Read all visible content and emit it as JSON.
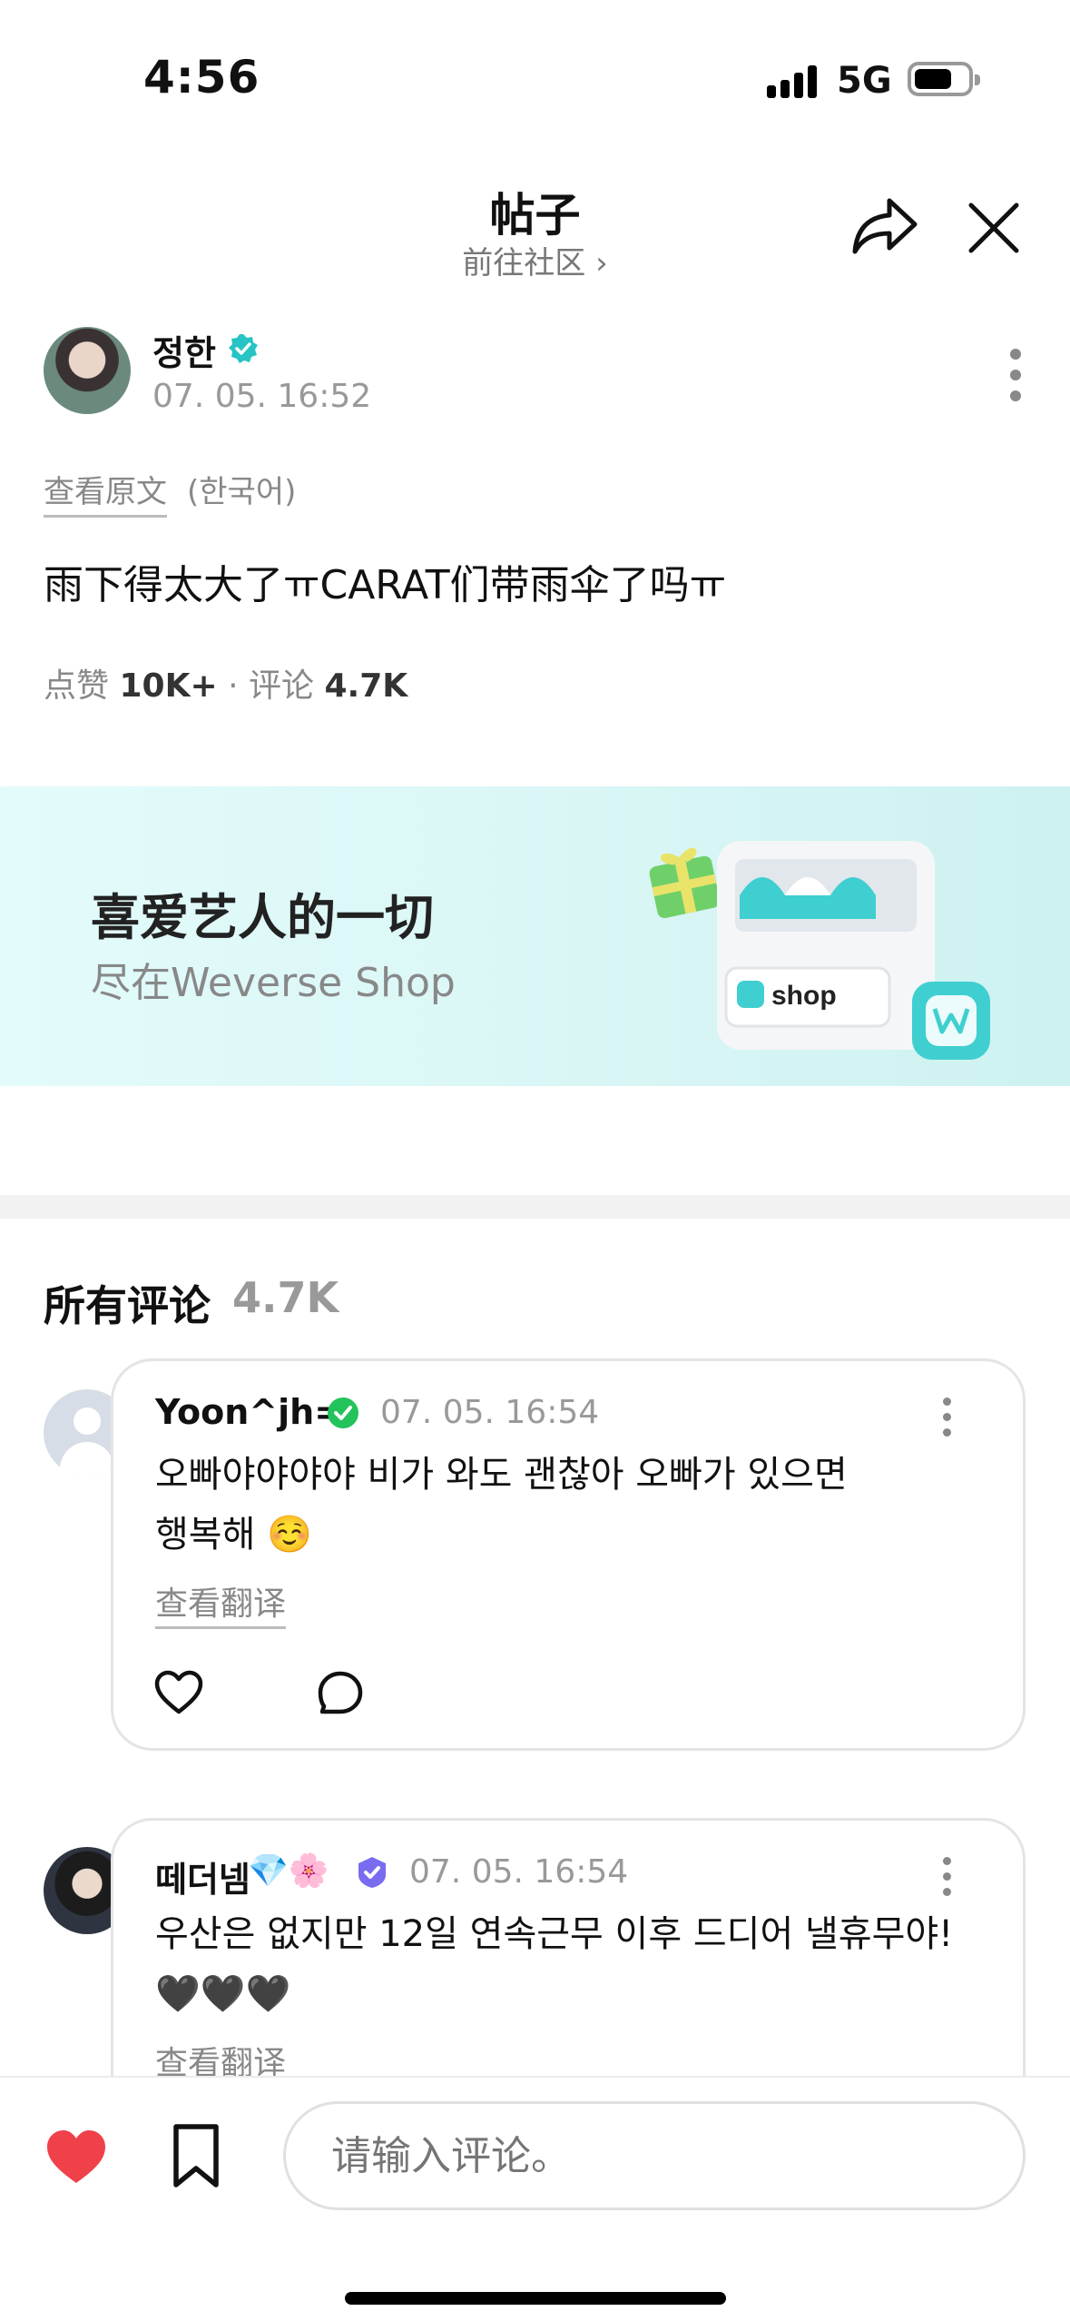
{
  "status_bar": {
    "time": "4:56",
    "network": "5G",
    "battery_level": 0.72
  },
  "header": {
    "title": "帖子",
    "subtitle": "前往社区 ›",
    "share_icon": "share-icon",
    "close_icon": "close-icon"
  },
  "post": {
    "author": "정한",
    "time": "07. 05. 16:52",
    "view_original": "查看原文",
    "original_language": "(한국어)",
    "body": "雨下得太大了ㅠCARAT们带雨伞了吗ㅠ",
    "likes_label": "点赞",
    "likes_count": "10K+",
    "separator": "·",
    "comments_label": "评论",
    "comments_count": "4.7K"
  },
  "banner": {
    "title": "喜爱艺人的一切",
    "subtitle": "尽在Weverse Shop",
    "shop_label": "shop",
    "accent": "#4dd6d6"
  },
  "comments_section": {
    "title": "所有评论",
    "count": "4.7K",
    "items": [
      {
        "user": "Yoon^jh=",
        "time": "07. 05. 16:54",
        "line1": "오빠야야야야 비가 와도 괜찮아 오빠가 있으면",
        "line2": "행복해 ☺️",
        "translate": "查看翻译"
      },
      {
        "user": "떼더넴",
        "emojis": "💎🌸",
        "time": "07. 05. 16:54",
        "line1": "우산은 없지만 12일 연속근무 이후 드디어 낼휴무야!",
        "line2": "🖤🖤🖤",
        "translate": "查看翻译"
      }
    ]
  },
  "bottom_bar": {
    "input_placeholder": "请输入评论。",
    "like_color": "#f0404a"
  }
}
